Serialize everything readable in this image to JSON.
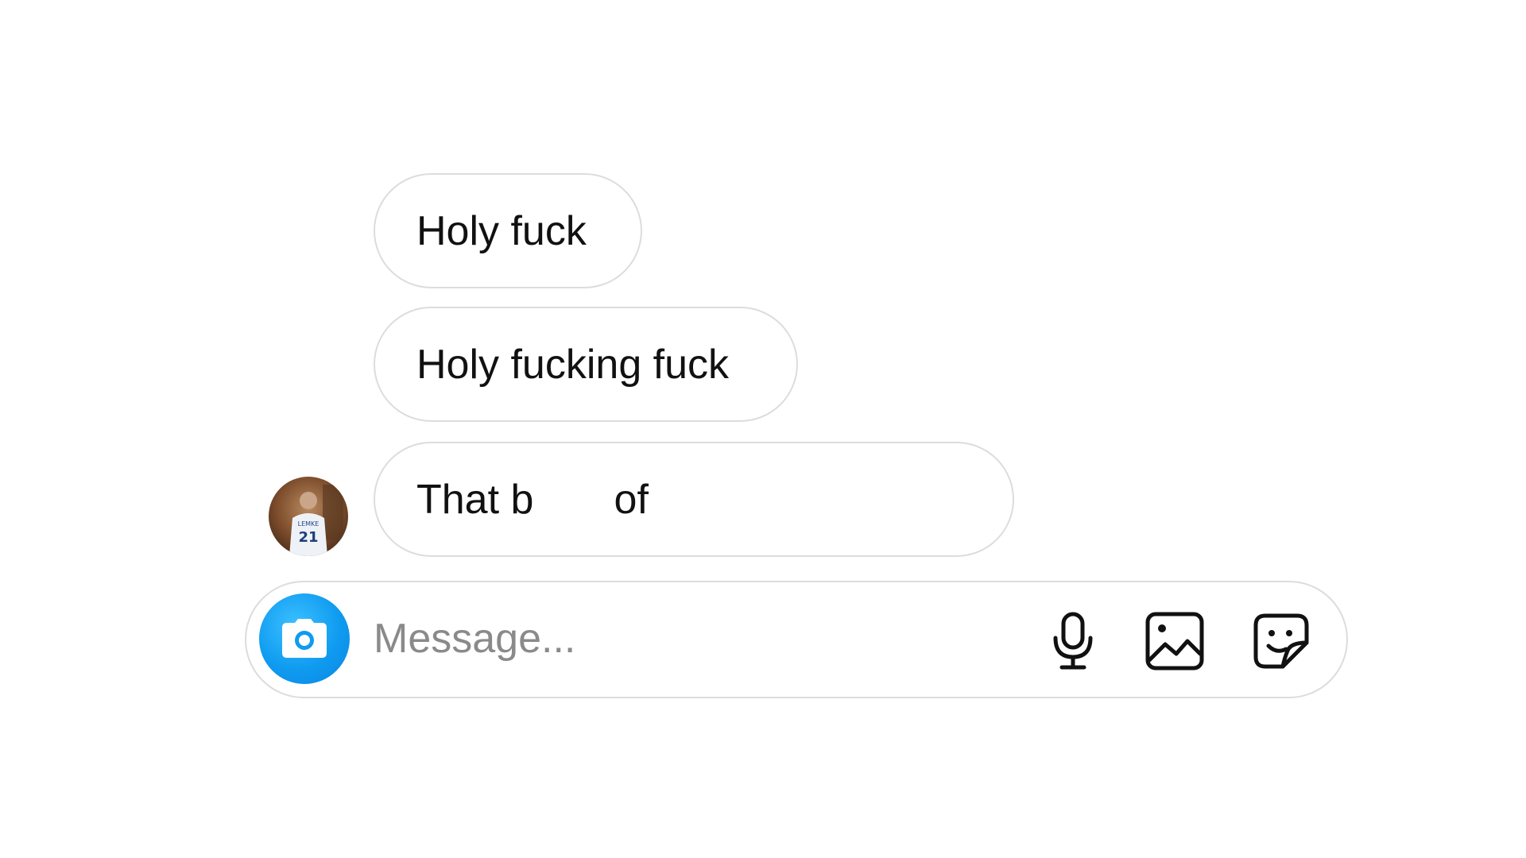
{
  "conversation": {
    "messages": [
      {
        "text": "Holy fuck"
      },
      {
        "text": "Holy fucking fuck"
      },
      {
        "text": "That b       of"
      }
    ],
    "sender_avatar": "avatar-photo"
  },
  "composer": {
    "placeholder": "Message...",
    "value": "",
    "camera_icon": "camera-icon",
    "mic_icon": "microphone-icon",
    "gallery_icon": "image-gallery-icon",
    "sticker_icon": "sticker-icon",
    "accent_color": "#0f9bf0"
  }
}
